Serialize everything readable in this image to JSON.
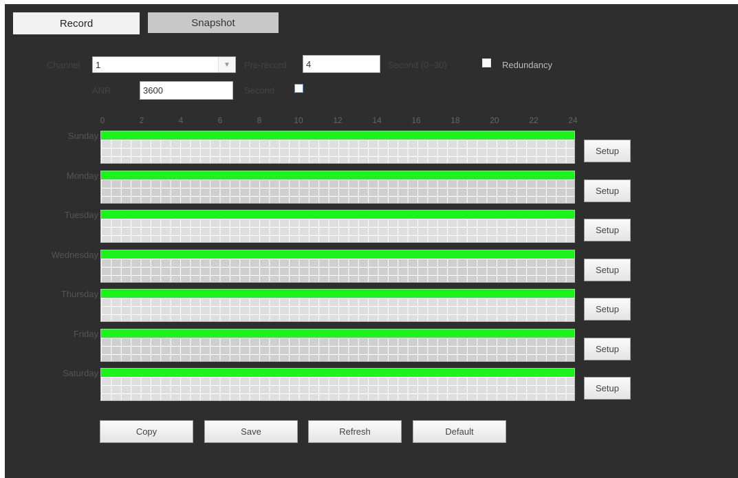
{
  "tabs": [
    {
      "label": "Record",
      "active": true
    },
    {
      "label": "Snapshot",
      "active": false
    }
  ],
  "form": {
    "channel_label": "Channel",
    "channel_value": "1",
    "prerecord_label": "Pre-record",
    "prerecord_value": "4",
    "prerecord_unit": "Second (0~30)",
    "redundancy_label": "Redundancy",
    "anr_label": "ANR",
    "anr_value": "3600",
    "anr_unit": "Second"
  },
  "schedule": {
    "hours": [
      "0",
      "2",
      "4",
      "6",
      "8",
      "10",
      "12",
      "14",
      "16",
      "18",
      "20",
      "22",
      "24"
    ],
    "days": [
      {
        "name": "Sunday",
        "record_from": 0,
        "record_to": 24,
        "setup_label": "Setup"
      },
      {
        "name": "Monday",
        "record_from": 0,
        "record_to": 24,
        "setup_label": "Setup"
      },
      {
        "name": "Tuesday",
        "record_from": 0,
        "record_to": 24,
        "setup_label": "Setup"
      },
      {
        "name": "Wednesday",
        "record_from": 0,
        "record_to": 24,
        "setup_label": "Setup"
      },
      {
        "name": "Thursday",
        "record_from": 0,
        "record_to": 24,
        "setup_label": "Setup"
      },
      {
        "name": "Friday",
        "record_from": 0,
        "record_to": 24,
        "setup_label": "Setup"
      },
      {
        "name": "Saturday",
        "record_from": 0,
        "record_to": 24,
        "setup_label": "Setup"
      }
    ],
    "record_color": "#1cf21c"
  },
  "buttons": {
    "copy": "Copy",
    "save": "Save",
    "refresh": "Refresh",
    "default": "Default"
  },
  "colors": {
    "titlebar": "#2e2e2e",
    "panel": "#f2f2f2",
    "grid": "#dedede"
  }
}
